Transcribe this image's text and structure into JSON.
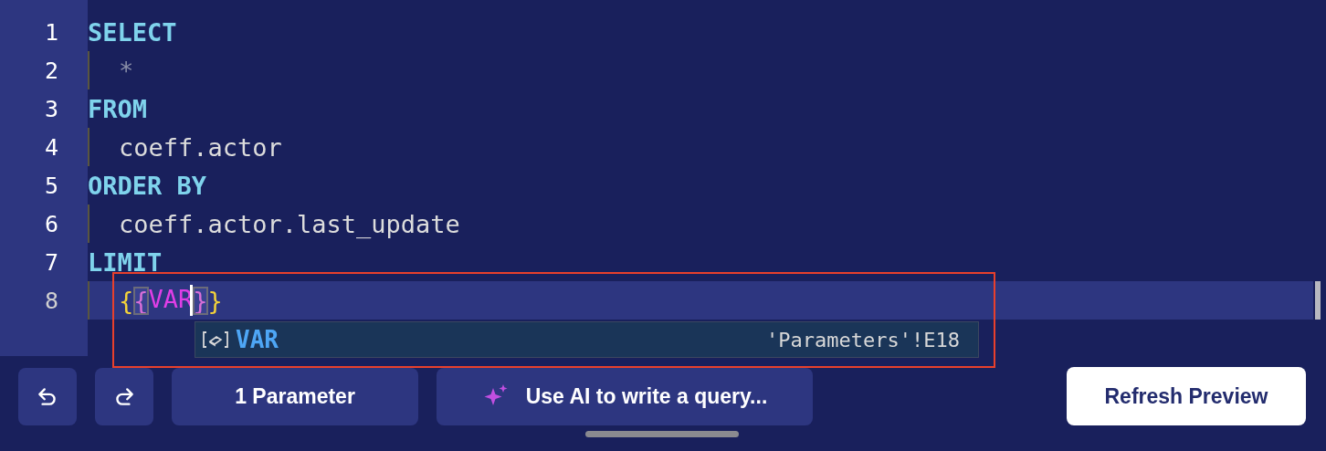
{
  "editor": {
    "lines": [
      {
        "number": "1",
        "indented": false,
        "current": false,
        "tokens": [
          {
            "text": "SELECT",
            "kind": "keyword"
          }
        ]
      },
      {
        "number": "2",
        "indented": true,
        "current": false,
        "tokens": [
          {
            "text": "*",
            "kind": "operator"
          }
        ]
      },
      {
        "number": "3",
        "indented": false,
        "current": false,
        "tokens": [
          {
            "text": "FROM",
            "kind": "keyword"
          }
        ]
      },
      {
        "number": "4",
        "indented": true,
        "current": false,
        "tokens": [
          {
            "text": "coeff.actor",
            "kind": "plain"
          }
        ]
      },
      {
        "number": "5",
        "indented": false,
        "current": false,
        "tokens": [
          {
            "text": "ORDER BY",
            "kind": "keyword"
          }
        ]
      },
      {
        "number": "6",
        "indented": true,
        "current": false,
        "tokens": [
          {
            "text": "coeff.actor.last_update",
            "kind": "plain"
          }
        ]
      },
      {
        "number": "7",
        "indented": false,
        "current": false,
        "tokens": [
          {
            "text": "LIMIT",
            "kind": "keyword"
          }
        ]
      },
      {
        "number": "8",
        "indented": true,
        "current": true,
        "tokens": [
          {
            "text": "{",
            "kind": "outer-brace"
          },
          {
            "text": "{",
            "kind": "inner-brace"
          },
          {
            "text": "VAR",
            "kind": "variable",
            "cursor": true
          },
          {
            "text": "}",
            "kind": "inner-brace"
          },
          {
            "text": "}",
            "kind": "outer-brace"
          }
        ]
      }
    ],
    "suggestion": {
      "label": "VAR",
      "detail": "'Parameters'!E18"
    }
  },
  "toolbar": {
    "parameters_button": "1 Parameter",
    "ai_button": "Use AI to write a query...",
    "refresh_button": "Refresh Preview"
  }
}
